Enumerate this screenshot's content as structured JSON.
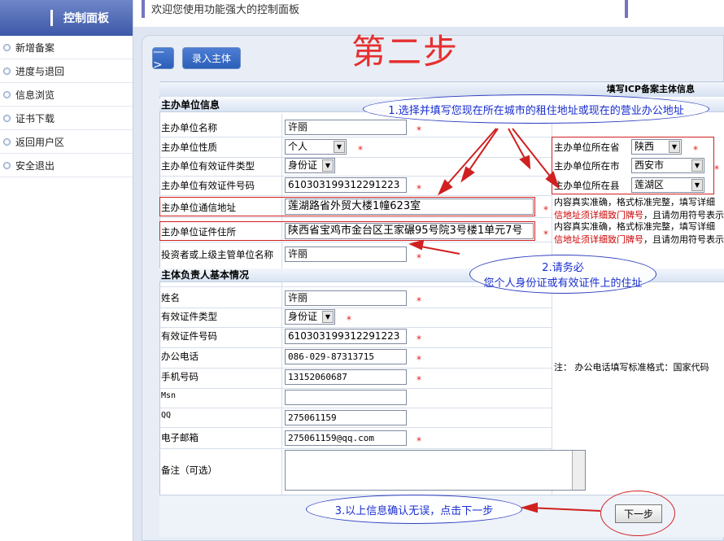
{
  "sidebar": {
    "title": "控制面板",
    "items": [
      {
        "label": "新增备案"
      },
      {
        "label": "进度与退回"
      },
      {
        "label": "信息浏览"
      },
      {
        "label": "证书下载"
      },
      {
        "label": "返回用户区"
      },
      {
        "label": "安全退出"
      }
    ]
  },
  "top": {
    "welcome": "欢迎您使用功能强大的控制面板"
  },
  "toolbar": {
    "arrow": "—>",
    "enter": "录入主体"
  },
  "step": "第二步",
  "form": {
    "title": "填写ICP备案主体信息",
    "section1": "主办单位信息",
    "unit_name_label": "主办单位名称",
    "unit_name": "许丽",
    "unit_type_label": "主办单位性质",
    "unit_type": "个人",
    "cert_type_label": "主办单位有效证件类型",
    "cert_type": "身份证",
    "cert_no_label": "主办单位有效证件号码",
    "cert_no": "610303199312291223",
    "province_label": "主办单位所在省",
    "province": "陕西",
    "city_label": "主办单位所在市",
    "city": "西安市",
    "county_label": "主办单位所在县",
    "county": "莲湖区",
    "address_label": "主办单位通信地址",
    "address": "莲湖路省外贸大楼1幢623室",
    "cert_addr_label": "主办单位证件住所",
    "cert_addr": "陕西省宝鸡市金台区王家碾95号院3号楼1单元7号",
    "investor_label": "投资者或上级主管单位名称",
    "investor": "许丽",
    "note1a": "内容真实准确，格式标准完整，填写详细",
    "note1b_red": "信地址须详细致门牌号",
    "note1b": "，且请勿用符号表示",
    "note2a": "内容真实准确，格式标准完整，填写详细",
    "note2b_red": "信地址须详细致门牌号",
    "note2b": "，且请勿用符号表示",
    "section2": "主体负责人基本情况",
    "name_label": "姓名",
    "name": "许丽",
    "p_cert_type_label": "有效证件类型",
    "p_cert_type": "身份证",
    "p_cert_no_label": "有效证件号码",
    "p_cert_no": "610303199312291223",
    "office_tel_label": "办公电话",
    "office_tel": "086-029-87313715",
    "mobile_label": "手机号码",
    "mobile": "13152060687",
    "msn_label": "Msn",
    "msn": "",
    "qq_label": "QQ",
    "qq": "275061159",
    "email_label": "电子邮箱",
    "email": "275061159@qq.com",
    "remark_label": "备注（可选）",
    "tel_note": "注： 办公电话填写标准格式：国家代码",
    "next": "下一步",
    "star": "*"
  },
  "annotations": {
    "a1": "1.选择并填写您现在所在城市的租住地址或现在的营业办公地址",
    "a2_line1": "2.请务必",
    "a2_line2": "您个人身份证或有效证件上的住址",
    "a3": "3.以上信息确认无误，点击下一步"
  },
  "colors": {
    "accent": "#2b5fb8",
    "annotation_red": "#d02020",
    "annotation_blue": "#2f3fc0"
  }
}
